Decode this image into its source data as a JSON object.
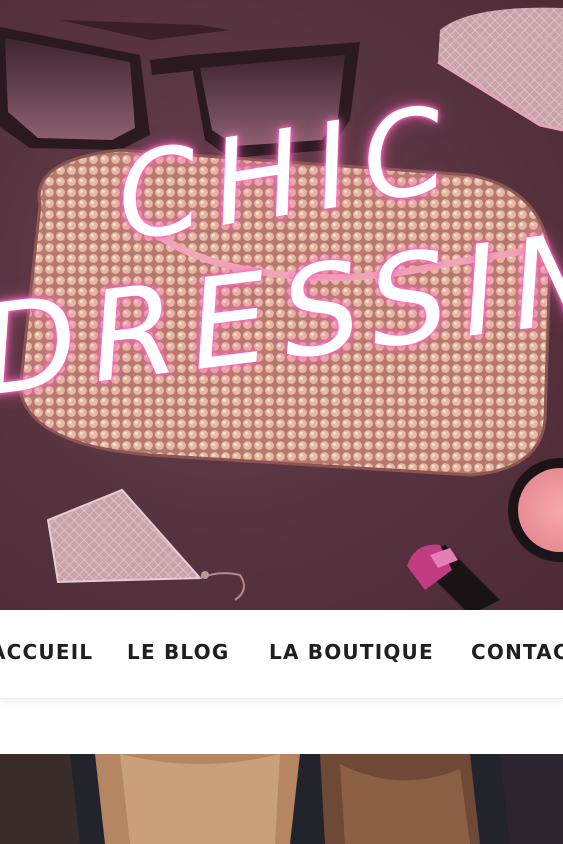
{
  "header": {
    "logo_line_1": "CHIC",
    "logo_line_2": "DRESSING",
    "logo_glow_color": "#ff73c4"
  },
  "nav": {
    "items": [
      {
        "label": "ACCUEIL"
      },
      {
        "label": "LE BLOG"
      },
      {
        "label": "LA BOUTIQUE"
      },
      {
        "label": "CONTACT"
      }
    ]
  },
  "colors": {
    "hero_background": "#5a3542",
    "nav_background": "#ffffff",
    "nav_text": "#1f1f1f"
  }
}
